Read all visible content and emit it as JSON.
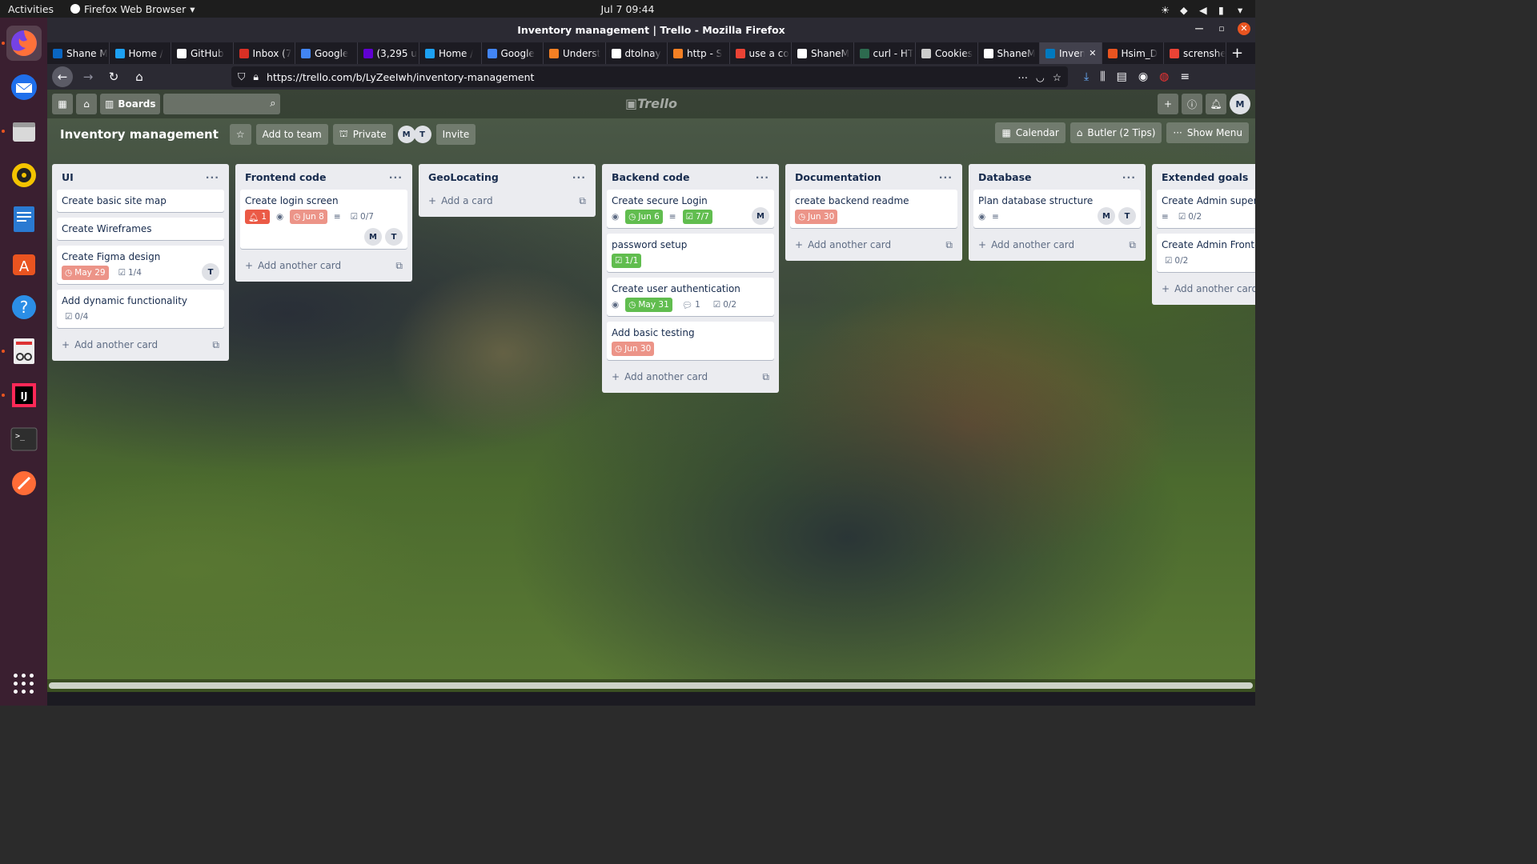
{
  "os": {
    "activities": "Activities",
    "app_name": "Firefox Web Browser",
    "clock": "Jul 7  09:44"
  },
  "window": {
    "title": "Inventory management | Trello - Mozilla Firefox"
  },
  "tabs": [
    {
      "label": "Shane M",
      "color": "#0a66c2"
    },
    {
      "label": "Home /",
      "color": "#1da1f2"
    },
    {
      "label": "GitHub",
      "color": "#ffffff"
    },
    {
      "label": "Inbox (7",
      "color": "#d93025"
    },
    {
      "label": "Google",
      "color": "#4285f4"
    },
    {
      "label": "(3,295 u",
      "color": "#6001d2"
    },
    {
      "label": "Home /",
      "color": "#1da1f2"
    },
    {
      "label": "Google",
      "color": "#4285f4"
    },
    {
      "label": "Underst",
      "color": "#f48024"
    },
    {
      "label": "dtolnay",
      "color": "#ffffff"
    },
    {
      "label": "http - S",
      "color": "#f48024"
    },
    {
      "label": "use a co",
      "color": "#ea4335"
    },
    {
      "label": "ShaneM",
      "color": "#ffffff"
    },
    {
      "label": "curl - HT",
      "color": "#2d6a4f"
    },
    {
      "label": "Cookies",
      "color": "#cccccc"
    },
    {
      "label": "ShaneM",
      "color": "#ffffff"
    },
    {
      "label": "Inven",
      "color": "#0079bf",
      "active": true
    },
    {
      "label": "Hsim_D",
      "color": "#e95420"
    },
    {
      "label": "screnshe",
      "color": "#ea4335"
    }
  ],
  "url": "https://trello.com/b/LyZeeIwh/inventory-management",
  "trello_header": {
    "boards_label": "Boards",
    "logo": "Trello"
  },
  "board": {
    "title": "Inventory management",
    "add_to_team": "Add to team",
    "private": "Private",
    "invite": "Invite",
    "members": [
      "M",
      "T"
    ],
    "calendar": "Calendar",
    "butler": "Butler (2 Tips)",
    "show_menu": "Show Menu",
    "user_initial": "M"
  },
  "lists": [
    {
      "title": "UI",
      "add_label": "Add another card",
      "cards": [
        {
          "title": "Create basic site map"
        },
        {
          "title": "Create Wireframes"
        },
        {
          "title": "Create Figma design",
          "due": "May 29",
          "due_style": "red",
          "checklist": "1/4",
          "members": [
            "T"
          ]
        },
        {
          "title": "Add dynamic functionality",
          "checklist": "0/4"
        }
      ]
    },
    {
      "title": "Frontend code",
      "add_label": "Add another card",
      "cards": [
        {
          "title": "Create login screen",
          "notify": "1",
          "watch": true,
          "due": "Jun 8",
          "due_style": "red",
          "description": true,
          "checklist": "0/7",
          "members": [
            "M",
            "T"
          ]
        }
      ]
    },
    {
      "title": "GeoLocating",
      "add_label": "Add a card",
      "cards": []
    },
    {
      "title": "Backend code",
      "add_label": "Add another card",
      "cards": [
        {
          "title": "Create secure Login",
          "watch": true,
          "due": "Jun 6",
          "due_style": "green",
          "description": true,
          "checklist": "7/7",
          "checklist_style": "green",
          "members": [
            "M"
          ]
        },
        {
          "title": "password setup",
          "checklist": "1/1",
          "checklist_style": "green"
        },
        {
          "title": "Create user authentication",
          "watch": true,
          "due": "May 31",
          "due_style": "green",
          "comments": "1",
          "checklist": "0/2"
        },
        {
          "title": "Add basic testing",
          "due": "Jun 30",
          "due_style": "red"
        }
      ]
    },
    {
      "title": "Documentation",
      "add_label": "Add another card",
      "cards": [
        {
          "title": "create backend readme",
          "due": "Jun 30",
          "due_style": "red"
        }
      ]
    },
    {
      "title": "Database",
      "add_label": "Add another card",
      "cards": [
        {
          "title": "Plan database structure",
          "watch": true,
          "description": true,
          "members": [
            "M",
            "T"
          ]
        }
      ]
    },
    {
      "title": "Extended goals",
      "add_label": "Add another card",
      "cards": [
        {
          "title": "Create Admin superuse",
          "description": true,
          "checklist": "0/2"
        },
        {
          "title": "Create Admin Fronten",
          "checklist": "0/2"
        }
      ]
    }
  ]
}
